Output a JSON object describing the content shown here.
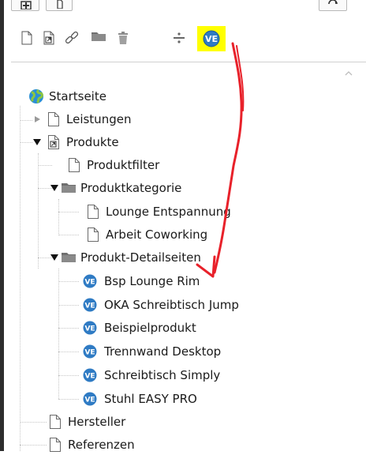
{
  "colors": {
    "highlight": "#ffff00",
    "arrow": "#e8212a",
    "ve_badge": "#2f7bc4",
    "globe": "#2a8fd6",
    "folder": "#7a7a7a"
  },
  "toolbar": {
    "top_buttons": [
      {
        "name": "new-content-button",
        "icon": "plus-page-icon"
      },
      {
        "name": "page-button",
        "icon": "page-icon"
      },
      {
        "name": "refresh-button",
        "icon": "refresh-icon"
      }
    ],
    "icons": [
      "new-page-icon",
      "shortcut-page-icon",
      "link-icon",
      "folder-icon",
      "trash-icon",
      "divider-icon",
      "ve-icon"
    ],
    "ve_badge_text": "VE"
  },
  "tree": {
    "root": {
      "label": "Startseite",
      "icon": "globe-icon"
    },
    "items": [
      {
        "label": "Leistungen",
        "icon": "page-icon",
        "toggle": "collapsed"
      },
      {
        "label": "Produkte",
        "icon": "shortcut-page-icon",
        "toggle": "expanded"
      },
      {
        "label": "Produktfilter",
        "icon": "page-icon"
      },
      {
        "label": "Produktkategorie",
        "icon": "folder-icon",
        "toggle": "expanded"
      },
      {
        "label": "Lounge Entspannung",
        "icon": "page-icon"
      },
      {
        "label": "Arbeit Coworking",
        "icon": "page-icon"
      },
      {
        "label": "Produkt-Detailseiten",
        "icon": "folder-icon",
        "toggle": "expanded"
      },
      {
        "label": "Bsp Lounge Rim",
        "icon": "ve-icon"
      },
      {
        "label": "OKA Schreibtisch Jump",
        "icon": "ve-icon"
      },
      {
        "label": "Beispielprodukt",
        "icon": "ve-icon"
      },
      {
        "label": "Trennwand Desktop",
        "icon": "ve-icon"
      },
      {
        "label": "Schreibtisch Simply",
        "icon": "ve-icon"
      },
      {
        "label": "Stuhl EASY PRO",
        "icon": "ve-icon"
      },
      {
        "label": "Hersteller",
        "icon": "page-icon"
      },
      {
        "label": "Referenzen",
        "icon": "page-icon"
      }
    ]
  }
}
